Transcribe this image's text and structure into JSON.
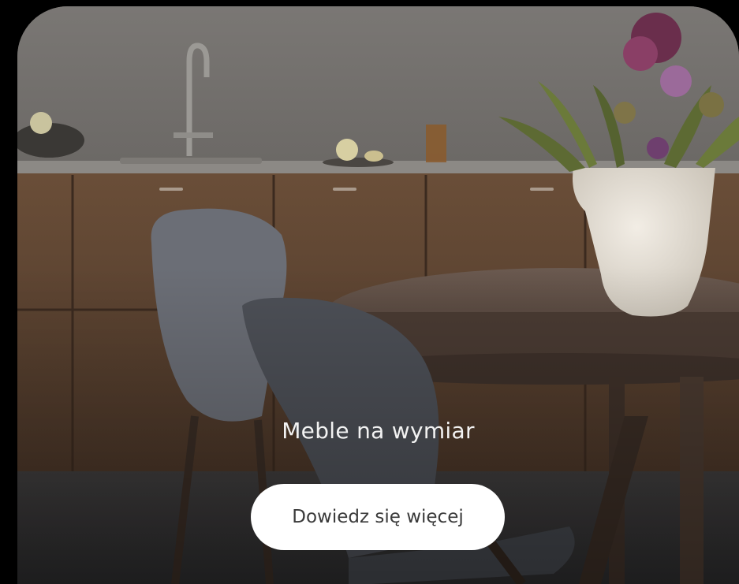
{
  "hero": {
    "headline": "Meble na wymiar",
    "cta_label": "Dowiedz się więcej"
  },
  "colors": {
    "background": "#000000",
    "wall": "#76736f",
    "cabinet": "#5b4331",
    "chair": "#62656c",
    "table": "#5a4940",
    "vase": "#e8e2d8",
    "flower": "#7a3b5c",
    "leaf": "#5d6a33",
    "button_bg": "#ffffff",
    "button_text": "#3a3a3a",
    "headline_text": "#f2f2f2"
  }
}
